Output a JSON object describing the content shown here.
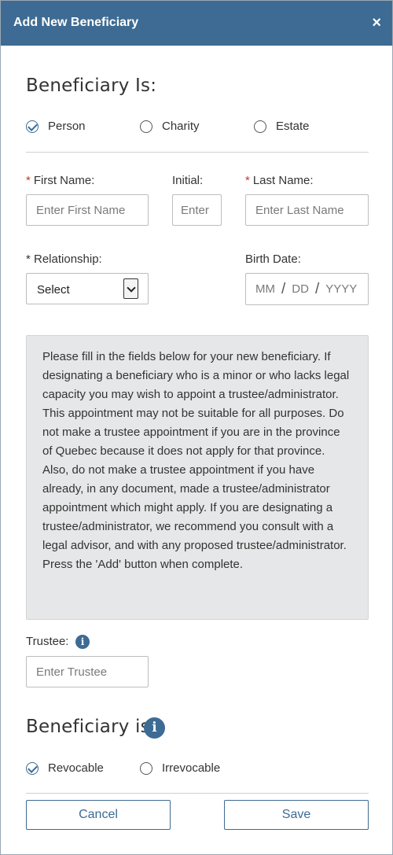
{
  "header": {
    "title": "Add New Beneficiary",
    "close_label": "×"
  },
  "beneficiary_type": {
    "title": "Beneficiary Is:",
    "options": [
      {
        "label": "Person",
        "checked": true
      },
      {
        "label": "Charity",
        "checked": false
      },
      {
        "label": "Estate",
        "checked": false
      }
    ]
  },
  "fields": {
    "first_name": {
      "label": "First Name:",
      "required_mark": "*",
      "placeholder": "Enter First Name"
    },
    "initial": {
      "label": "Initial:",
      "placeholder": "Enter"
    },
    "last_name": {
      "label": "Last Name:",
      "required_mark": "*",
      "placeholder": "Enter Last Name"
    },
    "relationship": {
      "label": "* Relationship:",
      "value": "Select"
    },
    "birth_date": {
      "label": "Birth Date:",
      "month": "MM",
      "day": "DD",
      "year": "YYYY",
      "separator": "/"
    }
  },
  "info": {
    "text": "Please fill in the fields below for your new beneficiary. If designating a beneficiary who is a minor or who lacks legal capacity you may wish to appoint a trustee/administrator. This appointment may not be suitable for all purposes. Do not make a trustee appointment if you are in the province of Quebec because it does not apply for that province. Also, do not make a trustee appointment if you have already, in any document, made a trustee/administrator appointment which might apply. If you are designating a trustee/administrator, we recommend you consult with a legal advisor, and with any proposed trustee/administrator.\nPress the 'Add' button when complete."
  },
  "trustee": {
    "label": "Trustee:",
    "placeholder": "Enter Trustee",
    "info_glyph": "i"
  },
  "revocability": {
    "title": "Beneficiary is:",
    "info_glyph": "i",
    "options": [
      {
        "label": "Revocable",
        "checked": true
      },
      {
        "label": "Irrevocable",
        "checked": false
      }
    ]
  },
  "buttons": {
    "cancel": "Cancel",
    "save": "Save"
  },
  "colors": {
    "accent": "#3d6b93",
    "required": "#c0392b",
    "info_bg": "#e6e7e8"
  },
  "icons": {
    "close": "close-icon",
    "info": "info-icon",
    "check": "checkmark-icon",
    "dropdown": "chevron-down-icon"
  }
}
